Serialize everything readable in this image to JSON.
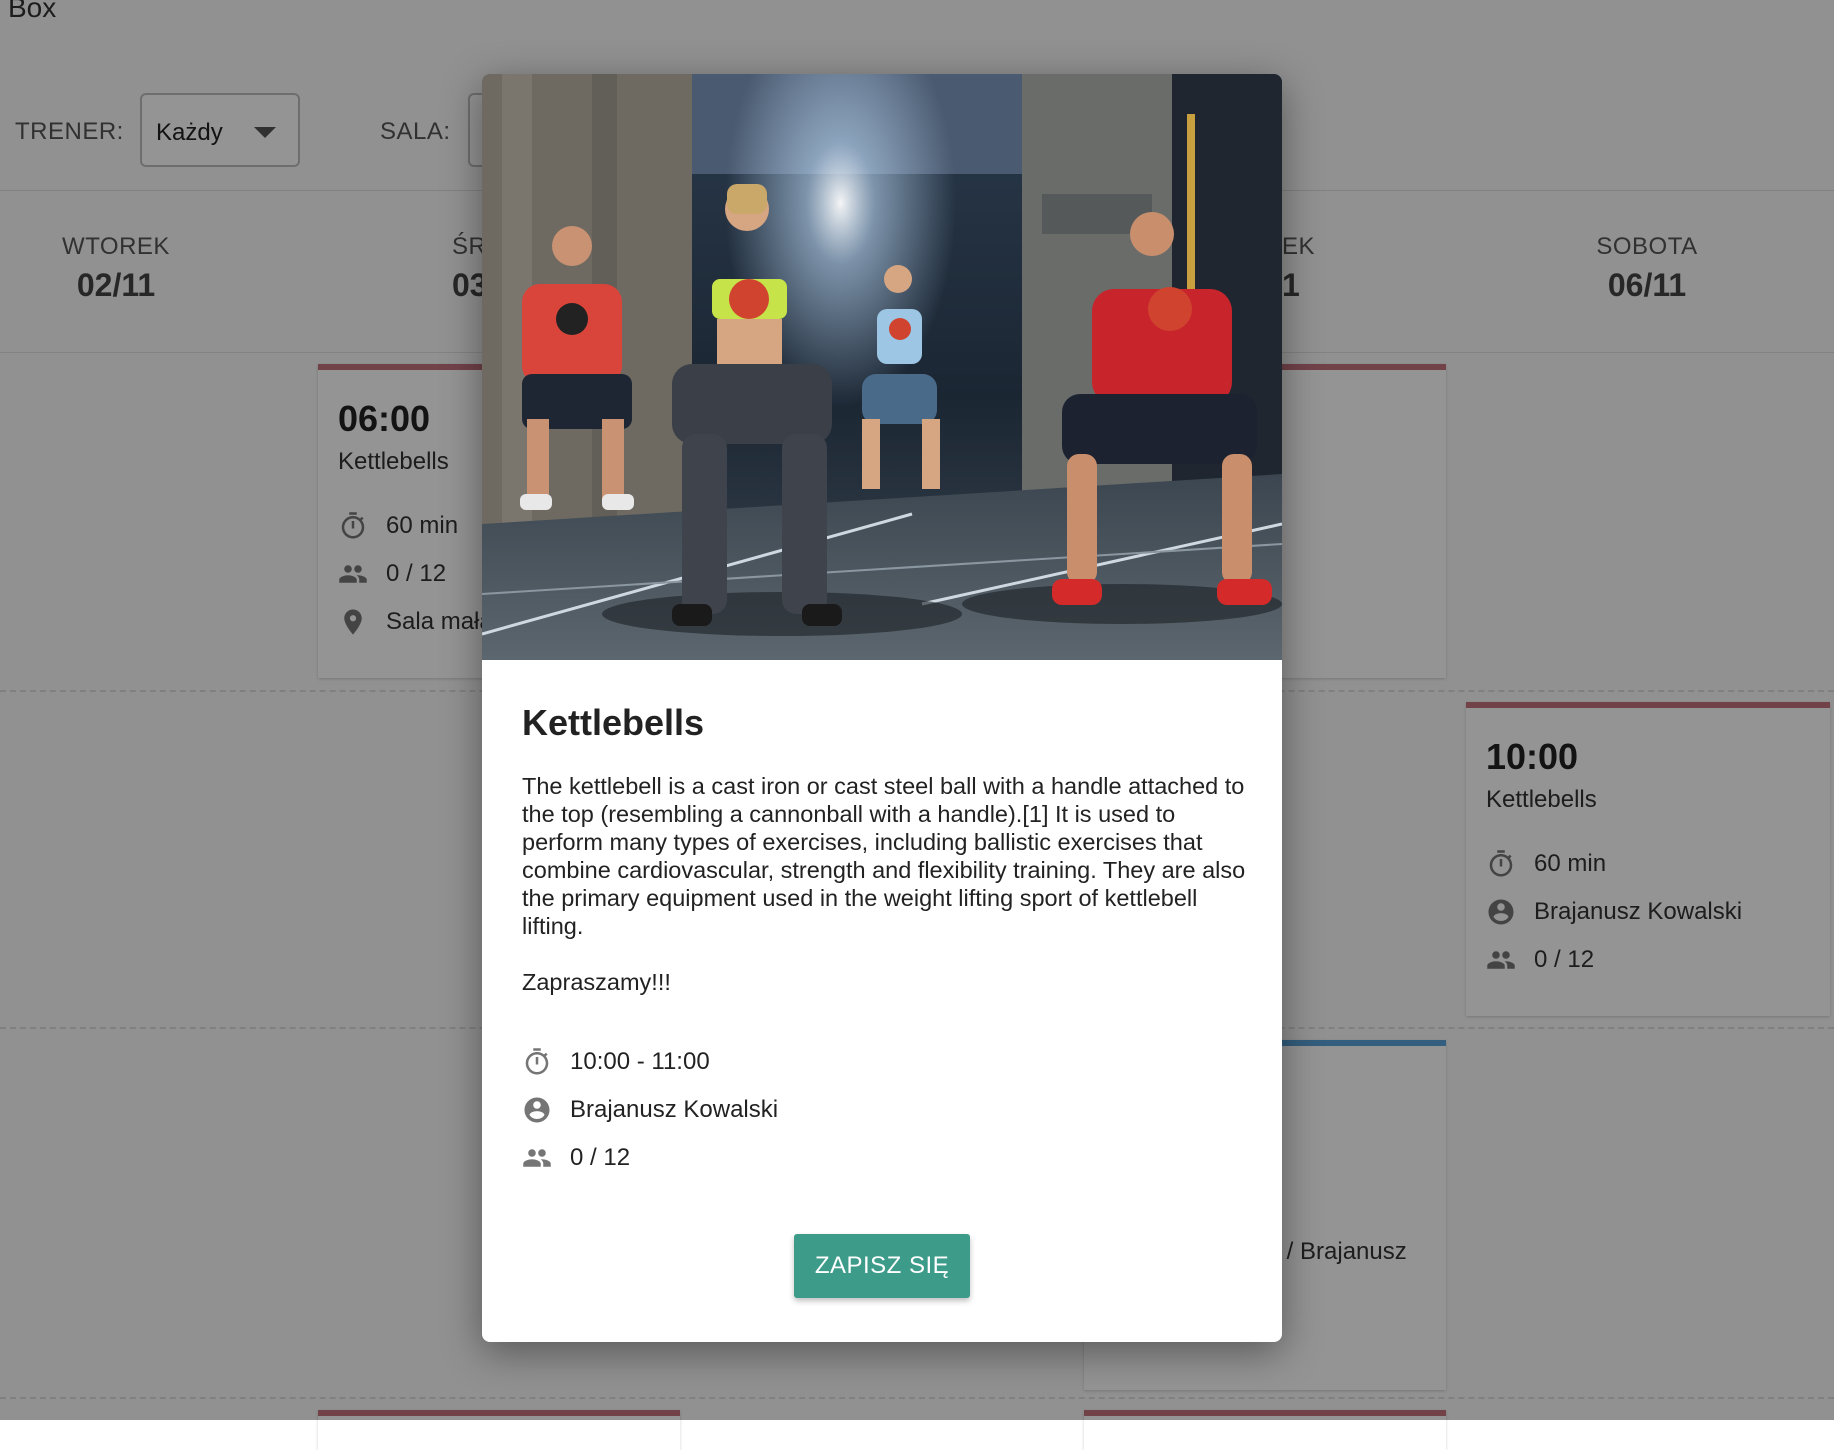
{
  "app": {
    "title": "Box"
  },
  "filters": {
    "trainer_label": "TRENER:",
    "trainer_value": "Każdy",
    "room_label": "SALA:"
  },
  "days": [
    {
      "name": "WTOREK",
      "date": "02/11"
    },
    {
      "name": "ŚR",
      "date": "03"
    },
    {
      "name": "EK",
      "date": "1"
    },
    {
      "name": "SOBOTA",
      "date": "06/11"
    }
  ],
  "cards": {
    "tuesday_0600": {
      "time": "06:00",
      "title": "Kettlebells",
      "duration": "60 min",
      "capacity": "0 / 12",
      "location": "Sala mała"
    },
    "saturday_1000": {
      "time": "10:00",
      "title": "Kettlebells",
      "duration": "60 min",
      "trainer": "Brajanusz Kowalski",
      "capacity": "0 / 12"
    },
    "friday_partial_text": "nt / Brajanusz"
  },
  "modal": {
    "title": "Kettlebells",
    "description": "The kettlebell is a cast iron or cast steel ball with a handle attached to the top (resembling a cannonball with a handle).[1] It is used to perform many types of exercises, including ballistic exercises that combine cardiovascular, strength and flexibility training. They are also the primary equipment used in the weight lifting sport of kettlebell lifting.",
    "invite": "Zapraszamy!!!",
    "time_range": "10:00 - 11:00",
    "trainer": "Brajanusz Kowalski",
    "capacity": "0 / 12",
    "enroll_label": "ZAPISZ SIĘ"
  },
  "colors": {
    "card_accent": "#c4737f",
    "card_accent_alt": "#5aa2d8",
    "primary_button": "#3d9b8a"
  },
  "icons": [
    "timer-icon",
    "people-icon",
    "location-pin-icon",
    "account-circle-icon",
    "caret-down-icon"
  ]
}
